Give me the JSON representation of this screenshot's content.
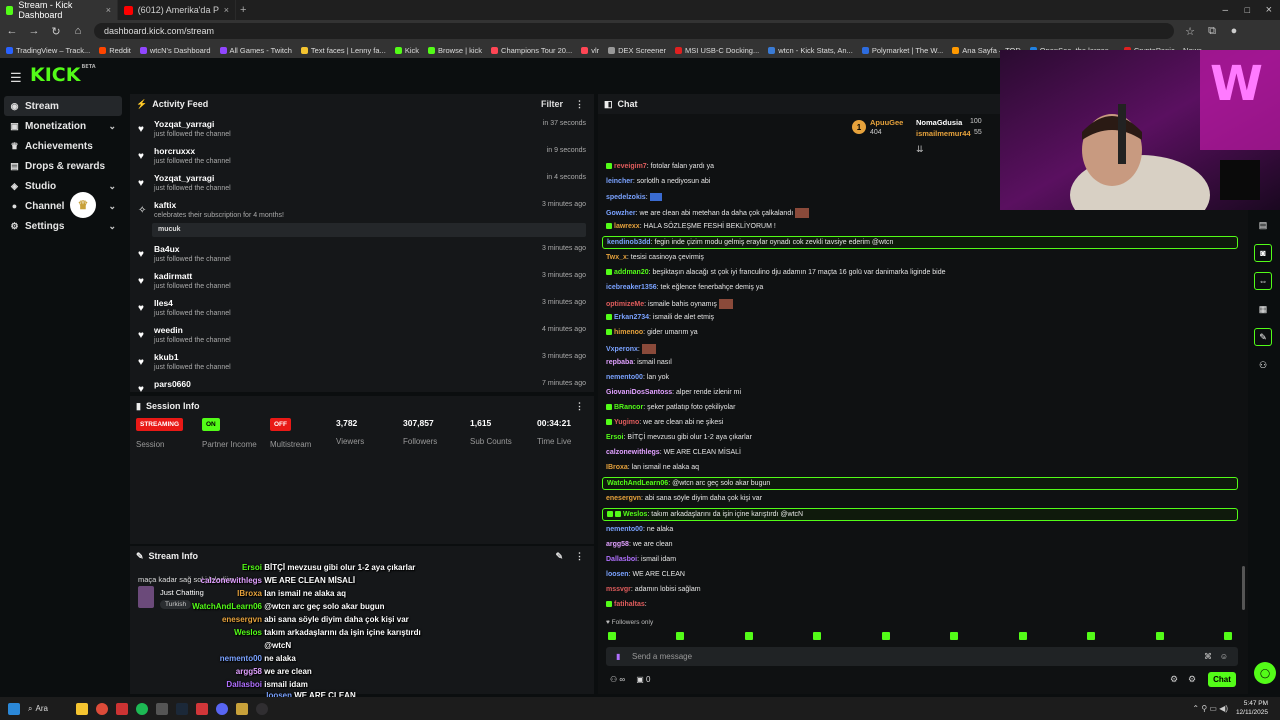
{
  "browser": {
    "tabs": [
      {
        "label": "Stream - Kick Dashboard",
        "active": true,
        "color": "#53fc18"
      },
      {
        "label": "(6012) Amerika'da Polisle Geçe",
        "active": false,
        "color": "#ff0000"
      }
    ],
    "url": "dashboard.kick.com/stream",
    "bookmarks": [
      "TradingView – Track...",
      "Reddit",
      "wtcN's Dashboard",
      "All Games - Twitch",
      "Text faces | Lenny fa...",
      "Kick",
      "Browse | kick",
      "Champions Tour 20...",
      "vlr",
      "DEX Screener",
      "MSI USB-C Docking...",
      "wtcn - Kick Stats, An...",
      "Polymarket | The W...",
      "Ana Sayfa – TOD",
      "OpenSea, the larges...",
      "CryptoPanic – News..."
    ],
    "bookmarks_folder": "Tüm Yer İşaretleri"
  },
  "kick": {
    "logo": "KICK",
    "logo_badge": "BETA"
  },
  "sidebar": {
    "items": [
      {
        "label": "Stream",
        "icon": "broadcast-icon",
        "chevron": false,
        "active": true
      },
      {
        "label": "Monetization",
        "icon": "wallet-icon",
        "chevron": true
      },
      {
        "label": "Achievements",
        "icon": "trophy-icon",
        "chevron": false
      },
      {
        "label": "Drops & rewards",
        "icon": "gift-icon",
        "chevron": false
      },
      {
        "label": "Studio",
        "icon": "gamepad-icon",
        "chevron": true
      },
      {
        "label": "Channel",
        "icon": "user-icon",
        "chevron": true
      },
      {
        "label": "Settings",
        "icon": "gear-icon",
        "chevron": true
      }
    ]
  },
  "activity": {
    "title": "Activity Feed",
    "filter": "Filter",
    "rows": [
      {
        "name": "Yozqat_yarragi",
        "sub": "just followed the channel",
        "time": "in 37 seconds"
      },
      {
        "name": "horcruxxx",
        "sub": "just followed the channel",
        "time": "in 9 seconds"
      },
      {
        "name": "Yozqat_yarragi",
        "sub": "just followed the channel",
        "time": "in 4 seconds"
      },
      {
        "name": "kaftix",
        "sub": "celebrates their subscription for 4 months!",
        "time": "3 minutes ago",
        "message": "mucuk"
      },
      {
        "name": "Ba4ux",
        "sub": "just followed the channel",
        "time": "3 minutes ago"
      },
      {
        "name": "kadirmatt",
        "sub": "just followed the channel",
        "time": "3 minutes ago"
      },
      {
        "name": "Iles4",
        "sub": "just followed the channel",
        "time": "3 minutes ago"
      },
      {
        "name": "weedin",
        "sub": "just followed the channel",
        "time": "4 minutes ago"
      },
      {
        "name": "kkub1",
        "sub": "just followed the channel",
        "time": "3 minutes ago"
      },
      {
        "name": "pars0660",
        "sub": "",
        "time": "7 minutes ago"
      }
    ]
  },
  "session": {
    "title": "Session Info",
    "session_pill": "STREAMING",
    "session_label": "Session",
    "partner_pill": "ON",
    "partner_label": "Partner Income",
    "multi_pill": "OFF",
    "multi_label": "Multistream",
    "viewers": "3,782",
    "viewers_label": "Viewers",
    "followers": "307,857",
    "followers_label": "Followers",
    "subs": "1,615",
    "subs_label": "Sub Counts",
    "time": "00:34:21",
    "time_label": "Time Live"
  },
  "streaminfo": {
    "title": "Stream Info",
    "stream_title": "maça kadar sağ sol j lelediim",
    "category": "Just Chatting",
    "tags": [
      "Turkish"
    ]
  },
  "chat": {
    "title": "Chat",
    "top": [
      {
        "name": "ApuuGee",
        "count": "404"
      },
      {
        "name": "NomaGdusia",
        "count": "100"
      },
      {
        "name": "ismailmemur44",
        "count": "55"
      }
    ],
    "lines": [
      {
        "user": "reveigim7",
        "color": "#e05c5c",
        "text": "fotolar falan yardı ya"
      },
      {
        "user": "leincher",
        "color": "#7aa2ff",
        "text": "sorlotlh a nediyosun abi"
      },
      {
        "user": "spedelzokis",
        "color": "#7aa2ff",
        "text": ""
      },
      {
        "user": "Gowzher",
        "color": "#7aa2ff",
        "text": "we are clean abi metehan da daha çok çalkalandı"
      },
      {
        "user": "lawrexx",
        "color": "#e6a23c",
        "text": "HALA SÖZLEŞME FESHİ BEKLİYORUM !"
      },
      {
        "user": "kendinob3dd",
        "color": "#7aa2ff",
        "text": "fegin inde çizim modu gelmiş eraylar oynadı cok zevkli tavsiye ederim @wtcn",
        "highlight": true
      },
      {
        "user": "Twx_x",
        "color": "#e6a23c",
        "text": "tesisi casinoya çevirmiş"
      },
      {
        "user": "addman20",
        "color": "#53fc18",
        "text": "beşiktaşın alacağı st çok iyi franculino dju adamın 17 maçta 16 golü var danimarka liginde bide"
      },
      {
        "user": "icebreaker1356",
        "color": "#7aa2ff",
        "text": "tek eğlence fenerbahçe demiş ya"
      },
      {
        "user": "optimizeMe",
        "color": "#e05c5c",
        "text": "ismaile bahis oynamış"
      },
      {
        "user": "Erkan2734",
        "color": "#7aa2ff",
        "text": "ismaili de alet etmiş"
      },
      {
        "user": "himenoo",
        "color": "#e6a23c",
        "text": "gider umarım ya"
      },
      {
        "user": "Vxperonx",
        "color": "#7aa2ff",
        "text": ""
      },
      {
        "user": "repbaba",
        "color": "#e0a0ff",
        "text": "ismail nasıl"
      },
      {
        "user": "nemento00",
        "color": "#7aa2ff",
        "text": "lan yok"
      },
      {
        "user": "GiovaniDosSantoss",
        "color": "#e0a0ff",
        "text": "alper rende izlenir mi"
      },
      {
        "user": "BRancor",
        "color": "#53fc18",
        "text": "şeker patlatıp foto çekiliyolar"
      },
      {
        "user": "Yugimo",
        "color": "#e05c5c",
        "text": "we are clean abi ne şikesi"
      },
      {
        "user": "Ersoi",
        "color": "#53fc18",
        "text": "BİTÇİ mevzusu gibi olur 1-2 aya çıkarlar"
      },
      {
        "user": "calzonewithlegs",
        "color": "#e0a0ff",
        "text": "WE ARE CLEAN MİSALİ"
      },
      {
        "user": "IBroxa",
        "color": "#e6a23c",
        "text": "lan ismail ne alaka aq"
      },
      {
        "user": "WatchAndLearn06",
        "color": "#53fc18",
        "text": "@wtcn arc geç solo akar bugun",
        "highlight": true
      },
      {
        "user": "enesergvn",
        "color": "#e6a23c",
        "text": "abi sana söyle diyim daha çok kişi var"
      },
      {
        "user": "Weslos",
        "color": "#53fc18",
        "text": "takım arkadaşlarını da işin içine karıştırdı @wtcN",
        "highlight": true
      },
      {
        "user": "nemento00",
        "color": "#7aa2ff",
        "text": "ne alaka"
      },
      {
        "user": "argg58",
        "color": "#e0a0ff",
        "text": "we are clean"
      },
      {
        "user": "Dallasboi",
        "color": "#b070ff",
        "text": "ismail idam"
      },
      {
        "user": "loosen",
        "color": "#7aa2ff",
        "text": "WE ARE CLEAN"
      },
      {
        "user": "mssvgr",
        "color": "#e05c5c",
        "text": "adamın lobisi sağlam"
      },
      {
        "user": "fatihaltas",
        "color": "#e05c5c",
        "text": ""
      }
    ],
    "followers_only": "Followers only",
    "placeholder": "Send a message",
    "send_label": "Chat",
    "points": "0"
  },
  "overlay": [
    {
      "user": "Ersoi",
      "color": "#53fc18",
      "text": "BİTÇİ mevzusu gibi olur 1-2 aya çıkarlar"
    },
    {
      "user": "calzonewithlegs",
      "color": "#e0a0ff",
      "text": "WE ARE CLEAN MİSALİ"
    },
    {
      "user": "IBroxa",
      "color": "#e6a23c",
      "text": "lan ismail ne alaka aq"
    },
    {
      "user": "WatchAndLearn06",
      "color": "#53fc18",
      "text": "@wtcn arc geç solo akar bugun"
    },
    {
      "user": "enesergvn",
      "color": "#e6a23c",
      "text": "abi sana söyle diyim daha çok kişi var"
    },
    {
      "user": "Weslos",
      "color": "#53fc18",
      "text": "takım arkadaşlarını da işin içine karıştırdı"
    },
    {
      "user": "",
      "color": "#ffffff",
      "text": "@wtcN"
    },
    {
      "user": "nemento00",
      "color": "#7aa2ff",
      "text": "ne alaka"
    },
    {
      "user": "argg58",
      "color": "#e0a0ff",
      "text": "we are clean"
    },
    {
      "user": "Dallasboi",
      "color": "#b070ff",
      "text": "ismail idam"
    },
    {
      "user": "loosen",
      "color": "#7aa2ff",
      "text": "WE ARE CLEAN"
    }
  ],
  "taskbar": {
    "search": "Ara",
    "time": "5:47 PM",
    "date": "12/11/2025"
  }
}
